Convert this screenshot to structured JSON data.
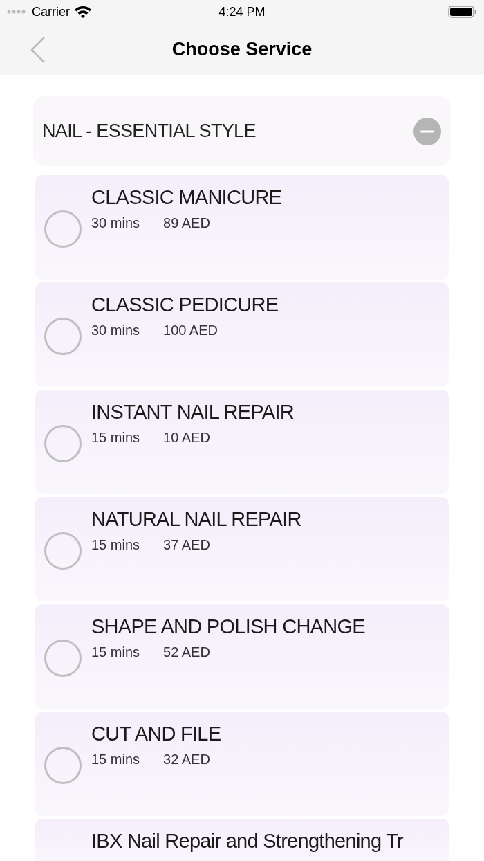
{
  "status_bar": {
    "carrier": "Carrier",
    "time": "4:24 PM"
  },
  "nav": {
    "title": "Choose Service"
  },
  "category": {
    "title": "NAIL - ESSENTIAL STYLE",
    "expanded": true
  },
  "services": [
    {
      "name": "CLASSIC MANICURE",
      "duration": "30 mins",
      "price": "89 AED",
      "selected": false
    },
    {
      "name": "CLASSIC PEDICURE",
      "duration": "30 mins",
      "price": "100 AED",
      "selected": false
    },
    {
      "name": "INSTANT NAIL REPAIR",
      "duration": "15 mins",
      "price": "10 AED",
      "selected": false
    },
    {
      "name": "NATURAL NAIL REPAIR",
      "duration": "15 mins",
      "price": "37 AED",
      "selected": false
    },
    {
      "name": "SHAPE AND POLISH CHANGE",
      "duration": "15 mins",
      "price": "52 AED",
      "selected": false
    },
    {
      "name": "CUT AND FILE",
      "duration": "15 mins",
      "price": "32 AED",
      "selected": false
    },
    {
      "name": "IBX Nail Repair and Strengthening Tr"
    }
  ]
}
